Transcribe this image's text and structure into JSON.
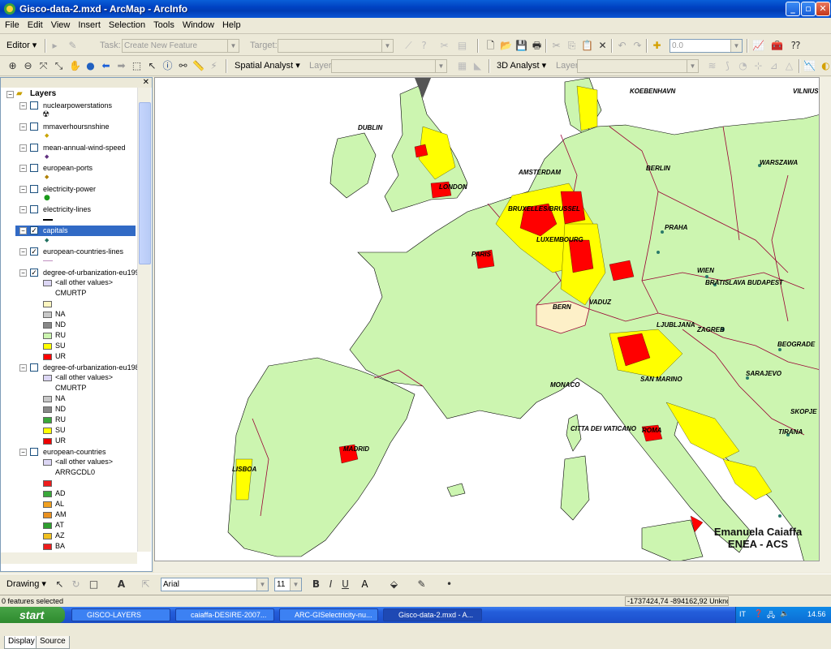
{
  "window": {
    "title": "Gisco-data-2.mxd - ArcMap - ArcInfo"
  },
  "menu": [
    "File",
    "Edit",
    "View",
    "Insert",
    "Selection",
    "Tools",
    "Window",
    "Help"
  ],
  "editor_toolbar": {
    "editor_label": "Editor ▾",
    "task_label": "Task:",
    "task_value": "Create New Feature",
    "target_label": "Target:",
    "scale_value": "0.0"
  },
  "tools_toolbar": {
    "spatial_analyst": "Spatial Analyst ▾",
    "layer_label": "Layer:",
    "analyst_3d": "3D Analyst ▾",
    "layer_label_2": "Layer:"
  },
  "toc": {
    "root": "Layers",
    "layers": [
      {
        "name": "nuclearpowerstations",
        "checked": false
      },
      {
        "name": "mmaverhoursnshine",
        "checked": false
      },
      {
        "name": "mean-annual-wind-speed",
        "checked": false
      },
      {
        "name": "european-ports",
        "checked": false
      },
      {
        "name": "electricity-power",
        "checked": false
      },
      {
        "name": "electricity-lines",
        "checked": false
      },
      {
        "name": "capitals",
        "checked": true,
        "selected": true
      },
      {
        "name": "european-countries-lines",
        "checked": true
      },
      {
        "name": "degree-of-urbanization-eu199",
        "checked": true
      },
      {
        "name": "degree-of-urbanization-eu198",
        "checked": false
      },
      {
        "name": "european-countries",
        "checked": false
      }
    ],
    "legend_urban": [
      "<all other values>",
      "CMURTP",
      "",
      "NA",
      "ND",
      "RU",
      "SU",
      "UR"
    ],
    "legend_urban_2": [
      "<all other values>",
      "CMURTP",
      "NA",
      "ND",
      "RU",
      "SU",
      "UR"
    ],
    "legend_countries": [
      "<all other values>",
      "ARRGCDL0",
      "",
      "AD",
      "AL",
      "AM",
      "AT",
      "AZ",
      "BA"
    ],
    "tabs": [
      "Display",
      "Source"
    ]
  },
  "map": {
    "cities": [
      "KOEBENHAVN",
      "VILNIUS",
      "DUBLIN",
      "AMSTERDAM",
      "BERLIN",
      "WARSZAWA",
      "LONDON",
      "BRUXELLES/BRUSSEL",
      "PRAHA",
      "LUXEMBOURG",
      "PARIS",
      "WIEN",
      "BRATISLAVA",
      "BUDAPEST",
      "BERN",
      "VADUZ",
      "LJUBLJANA",
      "ZAGREB",
      "BEOGRADE",
      "SARAJEVO",
      "SAN MARINO",
      "MONACO",
      "SKOPJE",
      "CITTA DEI VATICANO",
      "ROMA",
      "TIRANA",
      "MADRID",
      "LISBOA"
    ],
    "credit_line1": "Emanuela Caiaffa",
    "credit_line2": "ENEA - ACS",
    "colors": {
      "ru": "#ccf5b0",
      "su": "#ffff00",
      "ur": "#ff0000",
      "border": "#990033",
      "sea": "#ffffff",
      "swiss": "#fdf0c8"
    }
  },
  "drawing_toolbar": {
    "drawing_label": "Drawing ▾",
    "font_name": "Arial",
    "font_size": "11"
  },
  "status": {
    "left": "0 features selected",
    "coords": "-1737424,74  -894162,92 Unkno"
  },
  "taskbar": {
    "start": "start",
    "tasks": [
      "GISCO-LAYERS",
      "caiaffa-DESIRE-2007...",
      "ARC-GISelectricity-nu...",
      "Gisco-data-2.mxd - A..."
    ],
    "lang": "IT",
    "time": "14.56"
  }
}
